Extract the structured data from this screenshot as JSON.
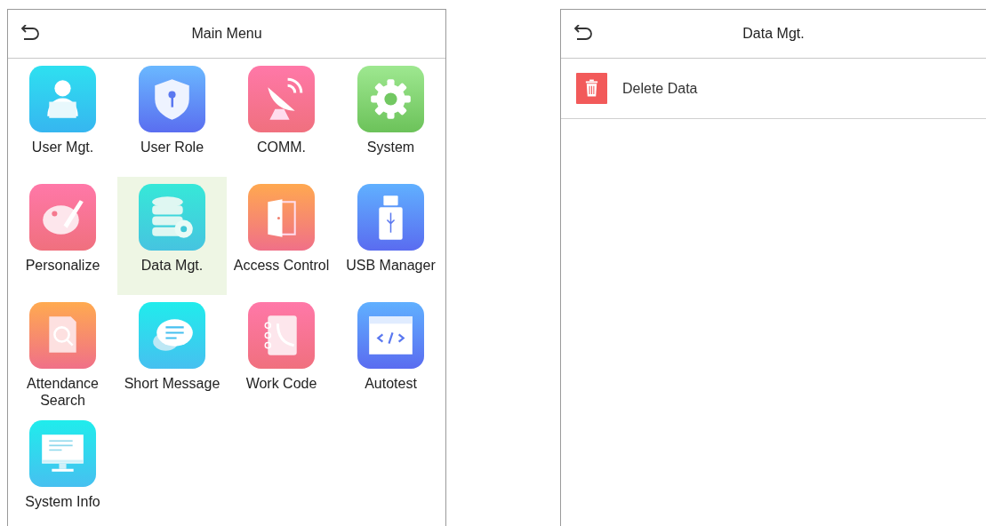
{
  "main_menu": {
    "title": "Main Menu",
    "items": [
      {
        "label": "User Mgt.",
        "kind": "user",
        "selected": false
      },
      {
        "label": "User Role",
        "kind": "shield",
        "selected": false
      },
      {
        "label": "COMM.",
        "kind": "dish",
        "selected": false
      },
      {
        "label": "System",
        "kind": "gear",
        "selected": false
      },
      {
        "label": "Personalize",
        "kind": "palette",
        "selected": false
      },
      {
        "label": "Data Mgt.",
        "kind": "database",
        "selected": true
      },
      {
        "label": "Access Control",
        "kind": "door",
        "selected": false
      },
      {
        "label": "USB Manager",
        "kind": "usb",
        "selected": false
      },
      {
        "label": "Attendance Search",
        "kind": "search",
        "selected": false
      },
      {
        "label": "Short Message",
        "kind": "chat",
        "selected": false
      },
      {
        "label": "Work Code",
        "kind": "phonebook",
        "selected": false
      },
      {
        "label": "Autotest",
        "kind": "code",
        "selected": false
      },
      {
        "label": "System Info",
        "kind": "monitor",
        "selected": false
      }
    ]
  },
  "data_mgt": {
    "title": "Data Mgt.",
    "items": [
      {
        "label": "Delete Data",
        "kind": "trash"
      }
    ]
  }
}
